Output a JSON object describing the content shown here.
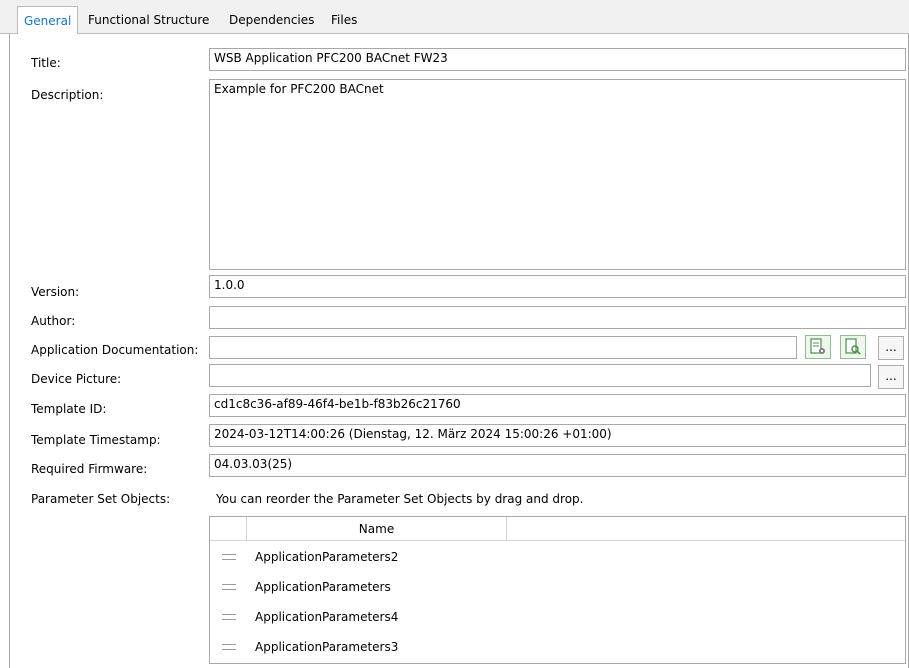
{
  "tabs": [
    {
      "label": "General",
      "active": true
    },
    {
      "label": "Functional Structure",
      "active": false
    },
    {
      "label": "Dependencies",
      "active": false
    },
    {
      "label": "Files",
      "active": false
    }
  ],
  "form": {
    "title_label": "Title:",
    "title_value": "WSB Application PFC200 BACnet FW23",
    "description_label": "Description:",
    "description_value": "Example for PFC200 BACnet",
    "version_label": "Version:",
    "version_value": "1.0.0",
    "author_label": "Author:",
    "author_value": "",
    "appdoc_label": "Application Documentation:",
    "appdoc_value": "",
    "browse_label": "...",
    "device_picture_label": "Device Picture:",
    "device_picture_value": "",
    "template_id_label": "Template ID:",
    "template_id_value": "cd1c8c36-af89-46f4-be1b-f83b26c21760",
    "template_ts_label": "Template Timestamp:",
    "template_ts_value": "2024-03-12T14:00:26 (Dienstag, 12. März 2024 15:00:26 +01:00)",
    "required_fw_label": "Required Firmware:",
    "required_fw_value": "04.03.03(25)",
    "pso_label": "Parameter Set Objects:",
    "pso_hint": "You can reorder the Parameter Set Objects by drag and drop."
  },
  "pso_table": {
    "column_name": "Name",
    "rows": [
      "ApplicationParameters2",
      "ApplicationParameters",
      "ApplicationParameters4",
      "ApplicationParameters3"
    ]
  },
  "colors": {
    "active_tab": "#1a73c7",
    "doc_icon": "#4a8f4a"
  },
  "icons": [
    "doc-settings-icon",
    "doc-search-icon",
    "drag-handle-icon"
  ]
}
